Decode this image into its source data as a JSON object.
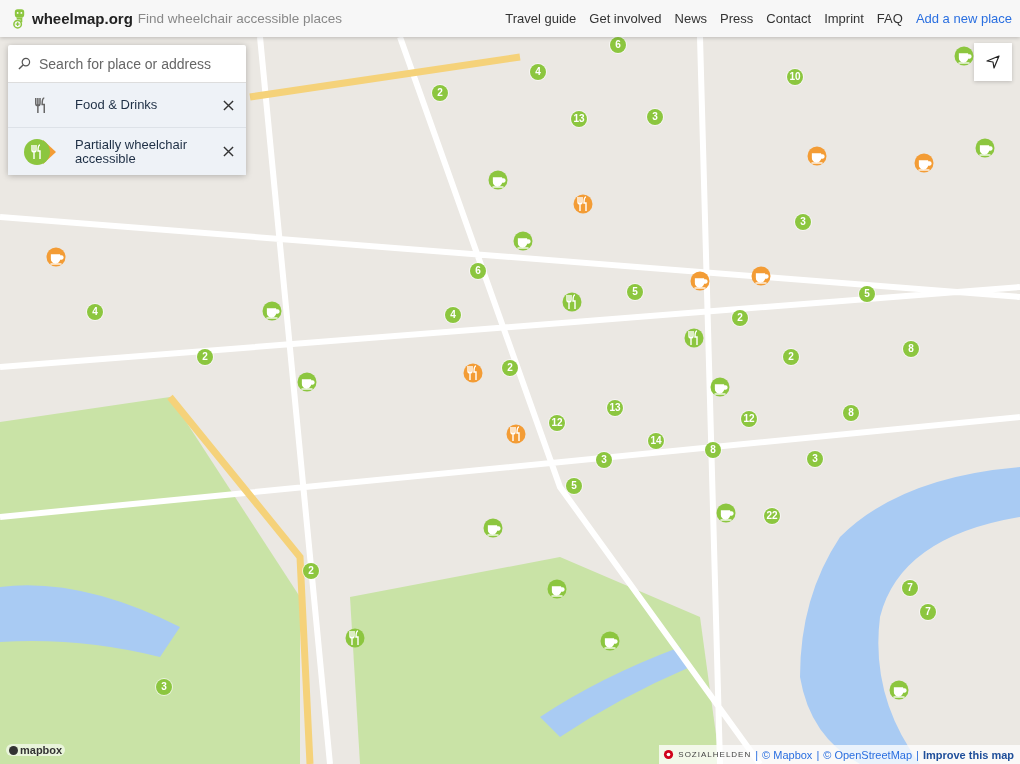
{
  "header": {
    "brand": "wheelmap.org",
    "tagline": "Find wheelchair accessible places",
    "nav": [
      {
        "label": "Travel guide",
        "kind": "plain"
      },
      {
        "label": "Get involved",
        "kind": "plain"
      },
      {
        "label": "News",
        "kind": "plain"
      },
      {
        "label": "Press",
        "kind": "plain"
      },
      {
        "label": "Contact",
        "kind": "plain"
      },
      {
        "label": "Imprint",
        "kind": "plain"
      },
      {
        "label": "FAQ",
        "kind": "plain"
      },
      {
        "label": "Add a new place",
        "kind": "primary"
      }
    ]
  },
  "search": {
    "placeholder": "Search for place or address"
  },
  "filters": [
    {
      "label": "Food & Drinks",
      "kind": "category"
    },
    {
      "label": "Partially wheelchair accessible",
      "kind": "accessibility"
    }
  ],
  "clusters": [
    {
      "count": "6"
    },
    {
      "count": "4"
    },
    {
      "count": "10"
    },
    {
      "count": "2"
    },
    {
      "count": "13"
    },
    {
      "count": "3"
    },
    {
      "count": "3"
    },
    {
      "count": "6"
    },
    {
      "count": "5"
    },
    {
      "count": "4"
    },
    {
      "count": "4"
    },
    {
      "count": "2"
    },
    {
      "count": "5"
    },
    {
      "count": "8"
    },
    {
      "count": "2"
    },
    {
      "count": "2"
    },
    {
      "count": "2"
    },
    {
      "count": "13"
    },
    {
      "count": "12"
    },
    {
      "count": "12"
    },
    {
      "count": "8"
    },
    {
      "count": "14"
    },
    {
      "count": "8"
    },
    {
      "count": "3"
    },
    {
      "count": "3"
    },
    {
      "count": "5"
    },
    {
      "count": "22"
    },
    {
      "count": "2"
    },
    {
      "count": "3"
    },
    {
      "count": "7"
    },
    {
      "count": "7"
    }
  ],
  "markers": [
    {
      "kind": "cafe",
      "color": "#8cc63f"
    },
    {
      "kind": "cafe",
      "color": "#8cc63f"
    },
    {
      "kind": "cafe",
      "color": "#8cc63f"
    },
    {
      "kind": "cafe",
      "color": "#8cc63f"
    },
    {
      "kind": "cafe",
      "color": "#8cc63f"
    },
    {
      "kind": "restaurant",
      "color": "#8cc63f"
    },
    {
      "kind": "restaurant",
      "color": "#8cc63f"
    },
    {
      "kind": "cafe",
      "color": "#8cc63f"
    },
    {
      "kind": "cafe",
      "color": "#8cc63f"
    },
    {
      "kind": "cafe",
      "color": "#8cc63f"
    },
    {
      "kind": "cafe",
      "color": "#8cc63f"
    },
    {
      "kind": "cafe",
      "color": "#8cc63f"
    },
    {
      "kind": "cafe",
      "color": "#8cc63f"
    },
    {
      "kind": "cafe",
      "color": "#8cc63f"
    },
    {
      "kind": "restaurant",
      "color": "#8cc63f"
    },
    {
      "kind": "restaurant",
      "color": "#f39c35"
    },
    {
      "kind": "restaurant",
      "color": "#f39c35"
    },
    {
      "kind": "restaurant",
      "color": "#f39c35"
    },
    {
      "kind": "cafe",
      "color": "#f39c35"
    },
    {
      "kind": "cafe",
      "color": "#f39c35"
    },
    {
      "kind": "cafe",
      "color": "#f39c35"
    },
    {
      "kind": "cafe",
      "color": "#f39c35"
    },
    {
      "kind": "cafe",
      "color": "#f39c35"
    }
  ],
  "attribution": {
    "logo": "mapbox",
    "org": "SOZIALHELDEN",
    "separator": "|",
    "links": [
      {
        "label": "© Mapbox",
        "kind": "link"
      },
      {
        "label": "© OpenStreetMap",
        "kind": "link"
      },
      {
        "label": "Improve this map",
        "kind": "strong"
      }
    ]
  }
}
